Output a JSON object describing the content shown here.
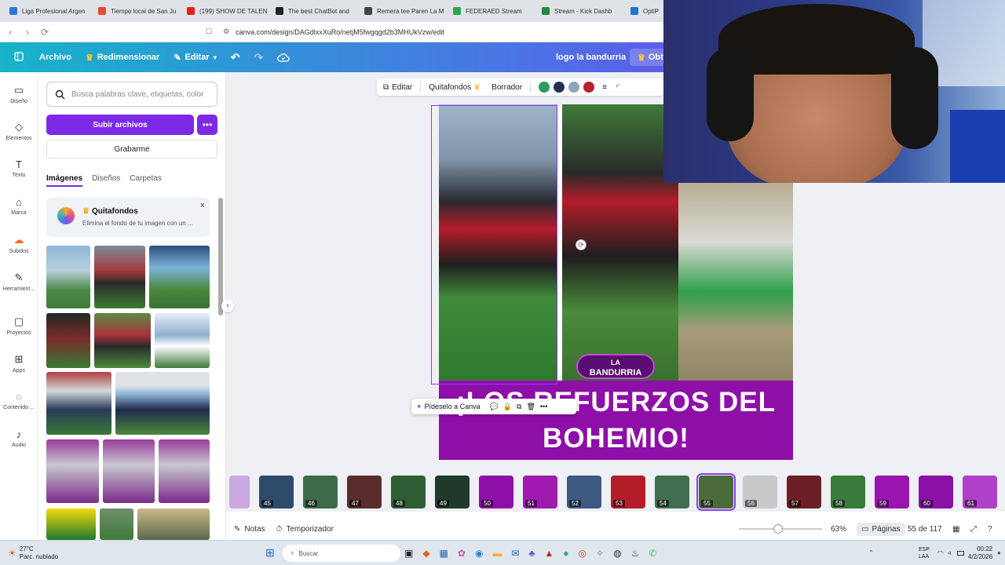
{
  "browser": {
    "tabs": [
      {
        "title": "Liga Profesional Argen",
        "color": "#2f76d2"
      },
      {
        "title": "Tiempo local de San Ju",
        "color": "#e54b2b"
      },
      {
        "title": "(199) SHOW DE TALEN",
        "color": "#e62117"
      },
      {
        "title": "The best ChatBot and",
        "color": "#222222"
      },
      {
        "title": "Remera tee Paren La M",
        "color": "#444444"
      },
      {
        "title": "FEDERAED Stream",
        "color": "#2aa84a"
      },
      {
        "title": "Stream - Kick Dashb",
        "color": "#1f8c3a"
      },
      {
        "title": "OptiP",
        "color": "#1f73c9"
      }
    ],
    "url": "canva.com/design/DAGdlxxXuRo/netjM5fwgqgd2b3MHUkVzw/edit"
  },
  "topbar": {
    "file": "Archivo",
    "resize": "Redimensionar",
    "edit": "Editar",
    "design_title": "logo la bandurria",
    "upgrade": "Obté"
  },
  "rail": [
    {
      "label": "Diseño",
      "icon": "layout-icon"
    },
    {
      "label": "Elementos",
      "icon": "elements-icon"
    },
    {
      "label": "Texto",
      "icon": "text-icon"
    },
    {
      "label": "Marca",
      "icon": "brand-icon"
    },
    {
      "label": "Subidos",
      "icon": "upload-cloud-icon"
    },
    {
      "label": "Herramient...",
      "icon": "tools-icon"
    },
    {
      "label": "Proyectos",
      "icon": "folder-icon"
    },
    {
      "label": "Apps",
      "icon": "apps-icon"
    },
    {
      "label": "Contenido ...",
      "icon": "magic-content-icon"
    },
    {
      "label": "Audio",
      "icon": "music-note-icon"
    }
  ],
  "panel": {
    "search_placeholder": "Busca palabras clave, etiquetas, color",
    "upload": "Subir archivos",
    "more": "•••",
    "record": "Grabarme",
    "tabs": [
      "Imágenes",
      "Diseños",
      "Carpetas"
    ],
    "promo_title": "Quitafondos",
    "promo_text": "Elimina el fondo de tu imagen con un ..."
  },
  "canvas_toolbar": {
    "edit": "Editar",
    "bg_remover": "Quitafondos",
    "erase": "Borrador",
    "colors": [
      "#2a9d5c",
      "#25305a",
      "#8fa3bf",
      "#b3232e"
    ]
  },
  "design": {
    "logo_line1": "LA",
    "logo_line2": "BANDURRIA",
    "headline1": "¡LOS REFUERZOS DEL",
    "headline2": "BOHEMIO!",
    "purple": "#8e0fa8"
  },
  "context_menu": {
    "ask": "Pídeselo a Canva"
  },
  "pages": [
    {
      "n": "45",
      "c": "#2e4a6b"
    },
    {
      "n": "46",
      "c": "#3c6b4a"
    },
    {
      "n": "47",
      "c": "#5a2d2d"
    },
    {
      "n": "48",
      "c": "#2f5e35"
    },
    {
      "n": "49",
      "c": "#1f3a2a"
    },
    {
      "n": "50",
      "c": "#8e0fa8"
    },
    {
      "n": "51",
      "c": "#a01ab0"
    },
    {
      "n": "52",
      "c": "#3d5a80"
    },
    {
      "n": "53",
      "c": "#b31d2a"
    },
    {
      "n": "54",
      "c": "#3f6f4f"
    },
    {
      "n": "55",
      "c": "#4a6b3a"
    },
    {
      "n": "56",
      "c": "#c9c9c9"
    },
    {
      "n": "57",
      "c": "#6b1f24"
    },
    {
      "n": "58",
      "c": "#3a7a3a"
    },
    {
      "n": "59",
      "c": "#9a14b0"
    },
    {
      "n": "60",
      "c": "#8a10a6"
    },
    {
      "n": "61",
      "c": "#b040c8"
    }
  ],
  "footer": {
    "notes": "Notas",
    "timer": "Temporizador",
    "zoom": "63%",
    "pages": "Páginas",
    "page_count": "55 de 117"
  },
  "taskbar": {
    "temp": "27°C",
    "weather": "Parc. nublado",
    "search": "Buscar",
    "lang1": "ESP",
    "lang2": "LAA",
    "time": "00:22",
    "date": "4/2/2026"
  }
}
